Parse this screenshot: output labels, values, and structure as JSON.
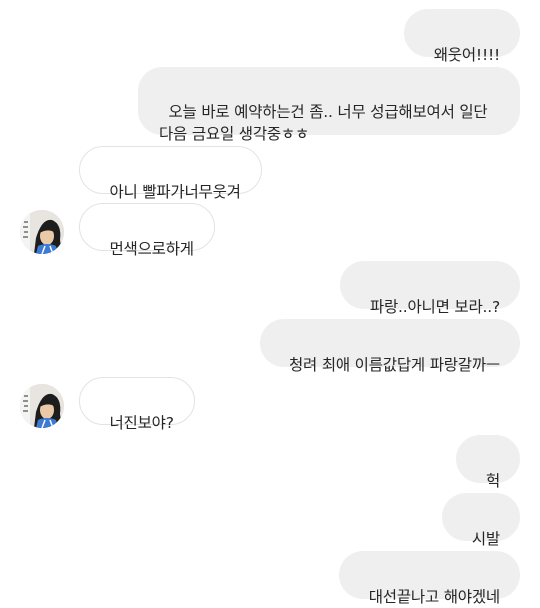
{
  "conversation": {
    "messages": [
      {
        "side": "sent",
        "text": "왜웃어!!!!"
      },
      {
        "side": "sent",
        "text": "오늘 바로 예약하는건 좀.. 너무 성급해보여서 일단\n다음 금요일 생각중ㅎㅎ"
      },
      {
        "side": "received",
        "text": "아니 빨파가너무웃겨"
      },
      {
        "side": "received",
        "text": "먼색으로하게"
      },
      {
        "side": "sent",
        "text": "파랑..아니면 보라..?"
      },
      {
        "side": "sent",
        "text": "청려 최애 이름값답게 파랑갈까ㅡ"
      },
      {
        "side": "received",
        "text": "너진보야?"
      },
      {
        "side": "sent",
        "text": "헉"
      },
      {
        "side": "sent",
        "text": "시발"
      },
      {
        "side": "sent",
        "text": "대선끝나고 해야겠네"
      }
    ]
  },
  "colors": {
    "sent_bubble": "#efefef",
    "received_border": "#e3e3e3",
    "text": "#262626",
    "background": "#ffffff"
  }
}
